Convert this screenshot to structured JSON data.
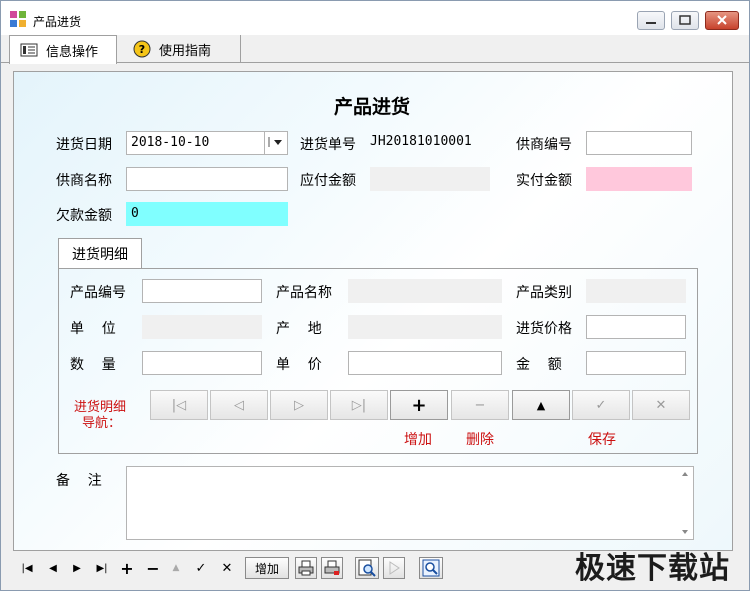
{
  "window": {
    "title": "产品进货",
    "tabs": [
      {
        "label": "信息操作",
        "icon": "info-panel-icon"
      },
      {
        "label": "使用指南",
        "icon": "help-icon"
      }
    ]
  },
  "form": {
    "heading": "产品进货",
    "date_label": "进货日期",
    "date_value": "2018-10-10",
    "order_no_label": "进货单号",
    "order_no_value": "JH20181010001",
    "supplier_no_label": "供商编号",
    "supplier_no_value": "",
    "supplier_name_label": "供商名称",
    "supplier_name_value": "",
    "payable_label": "应付金额",
    "payable_value": "",
    "paid_label": "实付金额",
    "paid_value": "",
    "debt_label": "欠款金额",
    "debt_value": "0"
  },
  "detail": {
    "tab_label": "进货明细",
    "product_no_label": "产品编号",
    "product_name_label": "产品名称",
    "category_label": "产品类别",
    "unit_label": "单    位",
    "origin_label": "产    地",
    "price_label": "进货价格",
    "qty_label": "数    量",
    "unit_price_label": "单    价",
    "amount_label": "金    额",
    "nav_label_line1": "进货明细",
    "nav_label_line2": "导航：",
    "nav_buttons": [
      {
        "glyph": "|◁",
        "icon": "first-record-icon"
      },
      {
        "glyph": "◁",
        "icon": "previous-record-icon"
      },
      {
        "glyph": "▷",
        "icon": "next-record-icon"
      },
      {
        "glyph": "▷|",
        "icon": "last-record-icon"
      },
      {
        "glyph": "+",
        "icon": "add-icon"
      },
      {
        "glyph": "−",
        "icon": "delete-icon"
      },
      {
        "glyph": "▲",
        "icon": "post-icon"
      },
      {
        "glyph": "✓",
        "icon": "check-icon"
      },
      {
        "glyph": "✕",
        "icon": "cancel-icon"
      }
    ],
    "add_caption": "增加",
    "delete_caption": "删除",
    "save_caption": "保存"
  },
  "remarks": {
    "label": "备    注",
    "value": ""
  },
  "bottom_toolbar": {
    "first": "|◀",
    "prev": "◀",
    "next": "▶",
    "last": "▶|",
    "insert": "+",
    "delete": "−",
    "edit": "▲",
    "post": "✓",
    "cancel": "✕",
    "add_button": "增加"
  },
  "watermark": "极速下载站",
  "colors": {
    "paid_field": "#ffc8dc",
    "debt_field": "#80ffff",
    "nav_caption": "#cc1111"
  }
}
